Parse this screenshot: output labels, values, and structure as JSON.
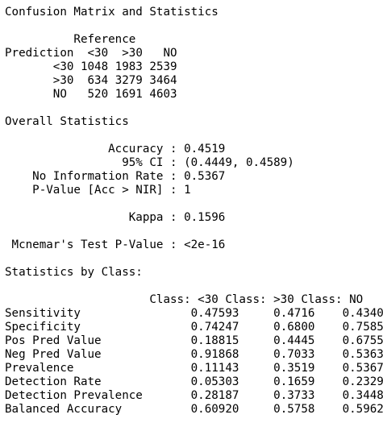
{
  "heading": "Confusion Matrix and Statistics",
  "matrix": {
    "reference_label": "Reference",
    "prediction_label": "Prediction",
    "columns": [
      "<30",
      ">30",
      "NO"
    ],
    "rows": [
      {
        "label": "<30",
        "values": [
          "1048",
          "1983",
          "2539"
        ]
      },
      {
        "label": ">30",
        "values": [
          "634",
          "3279",
          "3464"
        ]
      },
      {
        "label": "NO",
        "values": [
          "520",
          "1691",
          "4603"
        ]
      }
    ]
  },
  "overall": {
    "heading": "Overall Statistics",
    "stats": [
      {
        "name": "Accuracy",
        "value": "0.4519"
      },
      {
        "name": "95% CI",
        "value": "(0.4449, 0.4589)"
      },
      {
        "name": "No Information Rate",
        "value": "0.5367"
      },
      {
        "name": "P-Value [Acc > NIR]",
        "value": "1"
      },
      {
        "name": "Kappa",
        "value": "0.1596"
      },
      {
        "name": "Mcnemar's Test P-Value",
        "value": "<2e-16"
      }
    ]
  },
  "by_class": {
    "heading": "Statistics by Class:",
    "columns": [
      "Class: <30",
      "Class: >30",
      "Class: NO"
    ],
    "rows": [
      {
        "name": "Sensitivity",
        "values": [
          "0.47593",
          "0.4716",
          "0.4340"
        ]
      },
      {
        "name": "Specificity",
        "values": [
          "0.74247",
          "0.6800",
          "0.7585"
        ]
      },
      {
        "name": "Pos Pred Value",
        "values": [
          "0.18815",
          "0.4445",
          "0.6755"
        ]
      },
      {
        "name": "Neg Pred Value",
        "values": [
          "0.91868",
          "0.7033",
          "0.5363"
        ]
      },
      {
        "name": "Prevalence",
        "values": [
          "0.11143",
          "0.3519",
          "0.5367"
        ]
      },
      {
        "name": "Detection Rate",
        "values": [
          "0.05303",
          "0.1659",
          "0.2329"
        ]
      },
      {
        "name": "Detection Prevalence",
        "values": [
          "0.28187",
          "0.3733",
          "0.3448"
        ]
      },
      {
        "name": "Balanced Accuracy",
        "values": [
          "0.60920",
          "0.5758",
          "0.5962"
        ]
      }
    ]
  }
}
